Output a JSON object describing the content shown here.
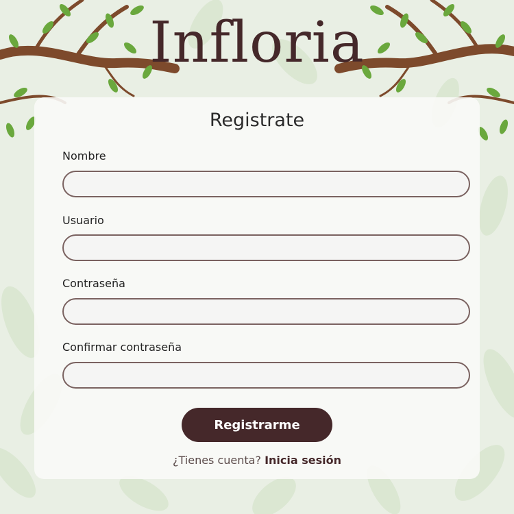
{
  "brand": {
    "logo_text": "Infloria"
  },
  "form": {
    "title": "Registrate",
    "fields": [
      {
        "label": "Nombre",
        "value": "",
        "placeholder": ""
      },
      {
        "label": "Usuario",
        "value": "",
        "placeholder": ""
      },
      {
        "label": "Contraseña",
        "value": "",
        "placeholder": ""
      },
      {
        "label": "Confirmar contraseña",
        "value": "",
        "placeholder": ""
      }
    ],
    "submit_label": "Registrarme"
  },
  "footer": {
    "prompt": "¿Tienes cuenta?",
    "link_label": "Inicia sesión"
  },
  "colors": {
    "primary": "#45282a",
    "input_border": "#7a6260",
    "leaf": "#6aa83d",
    "branch": "#7d4a2c"
  },
  "icons": [
    "leaf-icon",
    "branch-illustration"
  ]
}
